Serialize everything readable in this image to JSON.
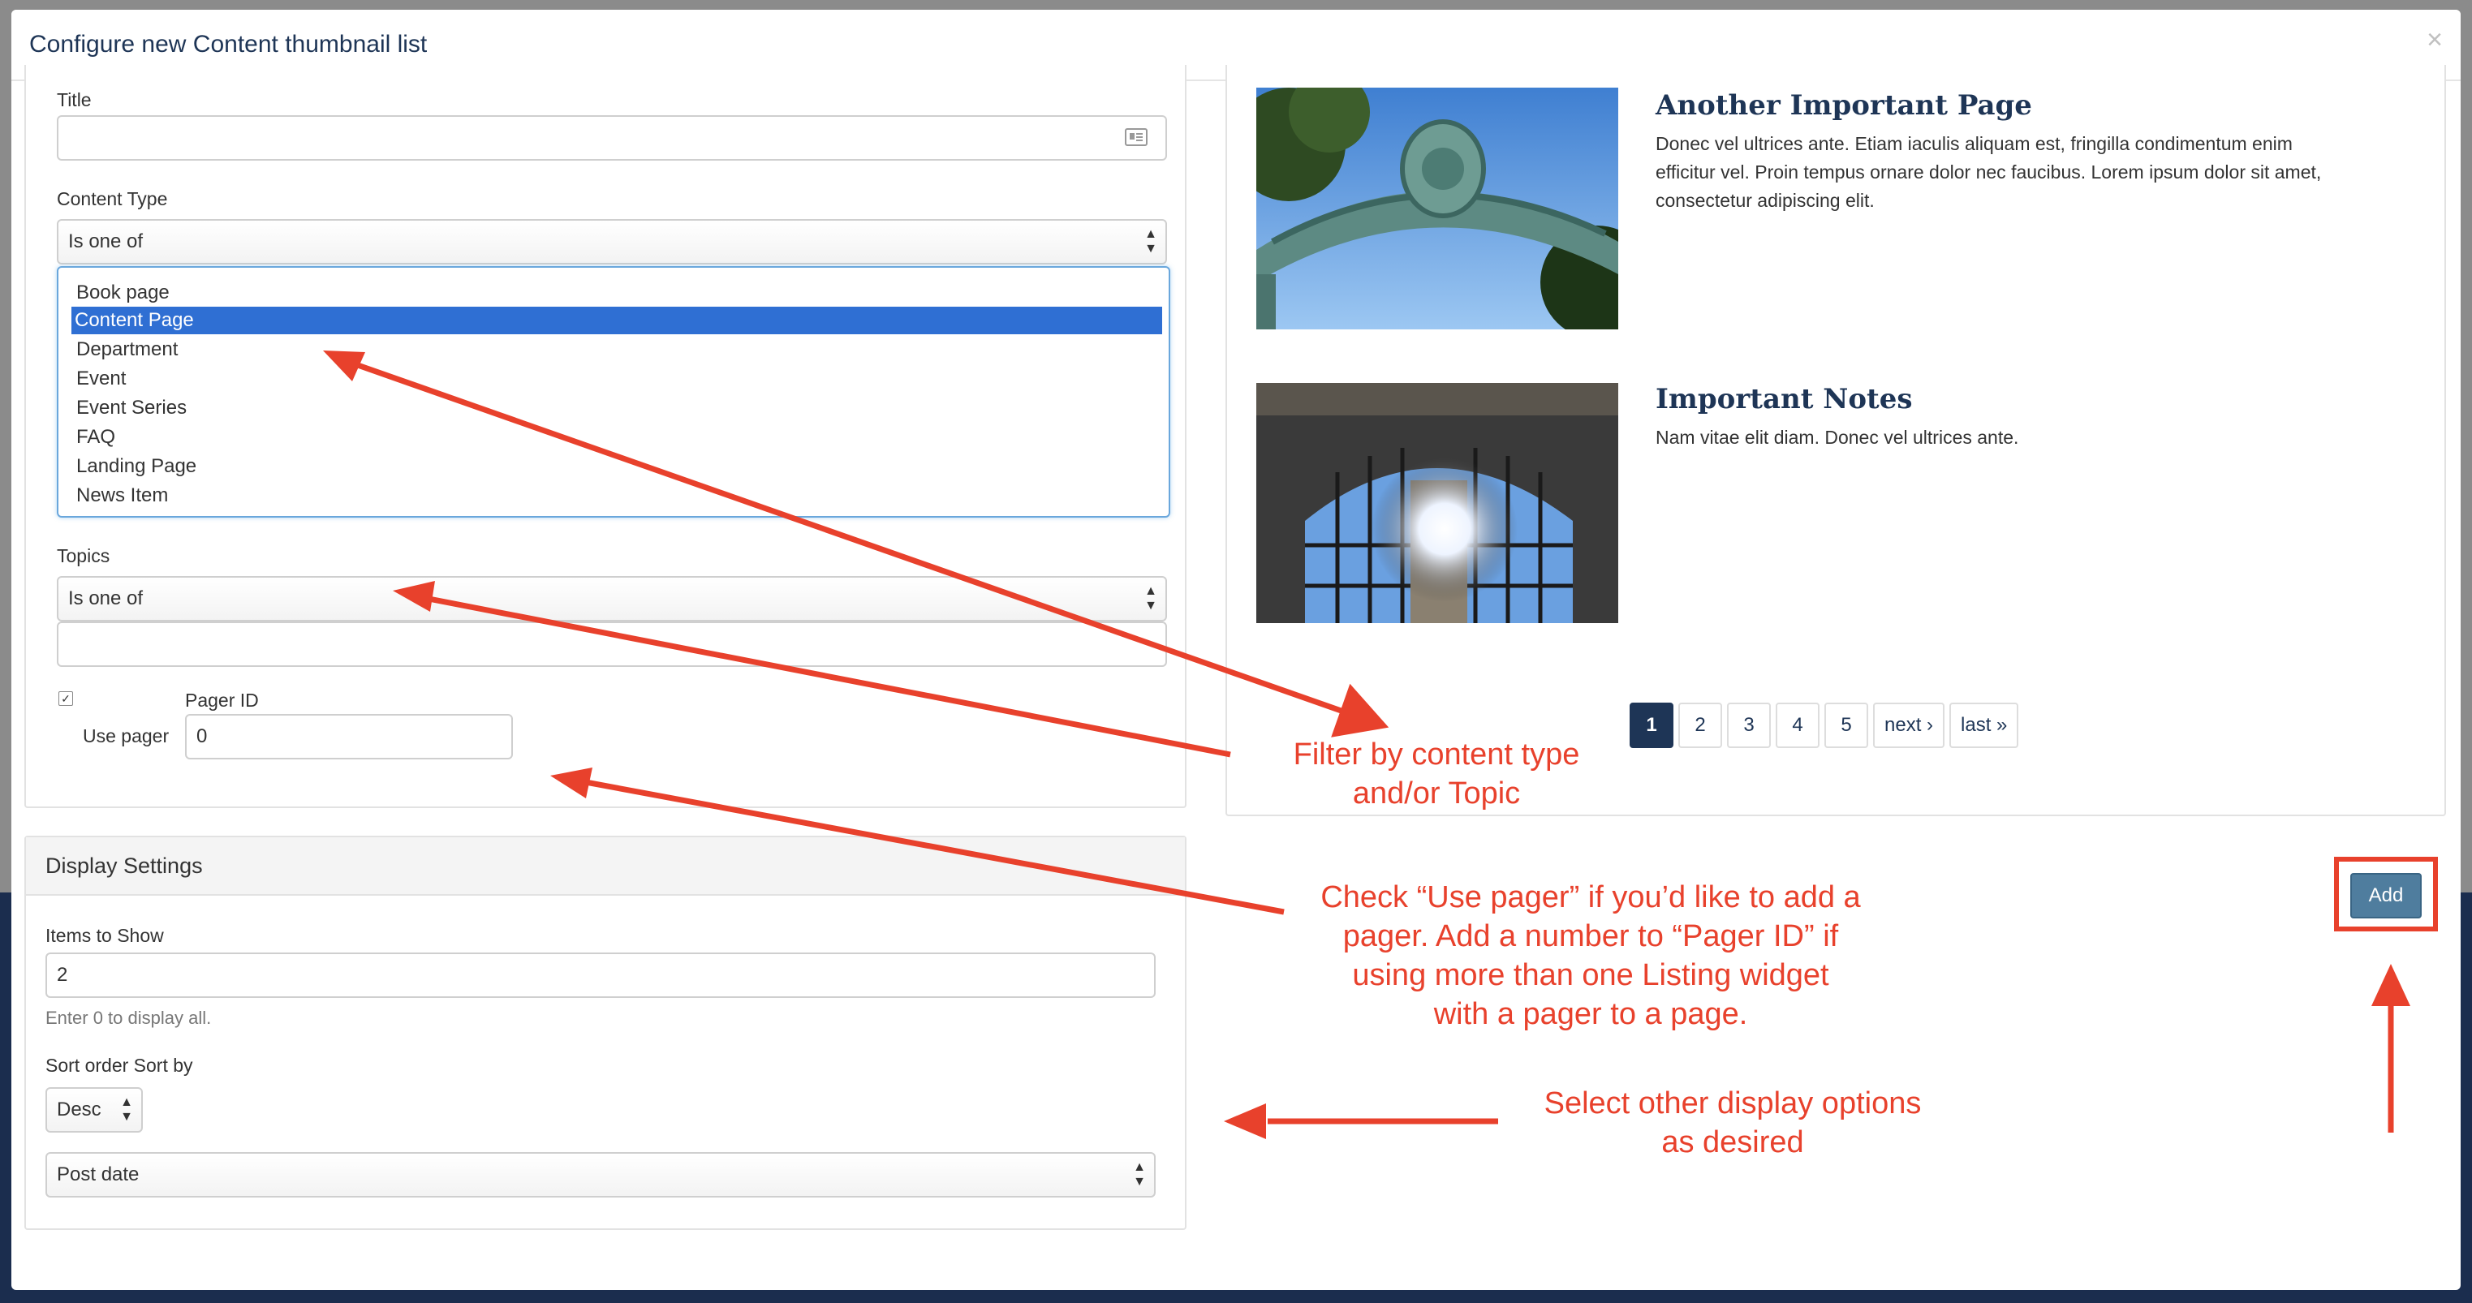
{
  "modal": {
    "title": "Configure new Content thumbnail list",
    "close": "×"
  },
  "filters": {
    "title_label": "Title",
    "title_value": "",
    "content_type_label": "Content Type",
    "content_type_operator": "Is one of",
    "content_type_options": [
      {
        "label": "Book page",
        "selected": false
      },
      {
        "label": "Content Page",
        "selected": true
      },
      {
        "label": "Department",
        "selected": false
      },
      {
        "label": "Event",
        "selected": false
      },
      {
        "label": "Event Series",
        "selected": false
      },
      {
        "label": "FAQ",
        "selected": false
      },
      {
        "label": "Landing Page",
        "selected": false
      },
      {
        "label": "News Item",
        "selected": false
      }
    ],
    "topics_label": "Topics",
    "topics_operator": "Is one of",
    "topics_value": "",
    "use_pager_label": "Use pager",
    "use_pager_checked": true,
    "pager_id_label": "Pager ID",
    "pager_id_value": "0"
  },
  "display": {
    "heading": "Display Settings",
    "items_label": "Items to Show",
    "items_value": "2",
    "items_help": "Enter 0 to display all.",
    "sort_label": "Sort order Sort by",
    "sort_order": "Desc",
    "sort_by": "Post date"
  },
  "preview": {
    "articles": [
      {
        "title": "Another Important Page",
        "body_lines": [
          "Donec vel ultrices ante. Etiam iaculis aliquam est, fringilla condimentum enim",
          "efficitur vel. Proin tempus ornare dolor nec faucibus. Lorem ipsum dolor sit amet,",
          "consectetur adipiscing elit."
        ]
      },
      {
        "title": "Important Notes",
        "body_lines": [
          "Nam vitae elit diam. Donec vel ultrices ante."
        ]
      }
    ],
    "pager": [
      "1",
      "2",
      "3",
      "4",
      "5",
      "next ›",
      "last »"
    ],
    "active_page": "1"
  },
  "actions": {
    "add_label": "Add"
  },
  "annotations": {
    "filter": [
      "Filter by content type",
      "and/or Topic"
    ],
    "pager": [
      "Check “Use pager” if you’d like to add a",
      "pager. Add a number to “Pager ID” if",
      "using more than one Listing widget",
      "with a pager to a page."
    ],
    "display": [
      "Select other display options",
      "as desired"
    ]
  },
  "colors": {
    "accent": "#1e3556",
    "annotation": "#e8412c",
    "selection": "#2f6fd3",
    "add_button": "#4f7d9e"
  }
}
